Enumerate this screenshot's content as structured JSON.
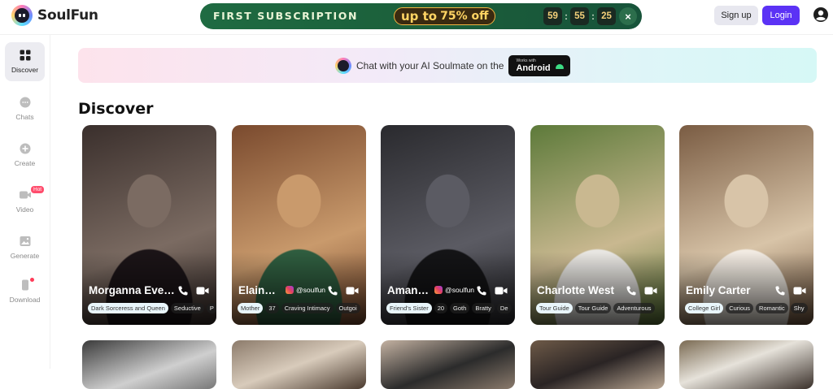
{
  "header": {
    "logo_text": "SoulFun",
    "promo": {
      "title": "FIRST SUBSCRIPTION",
      "offer_prefix": "up to",
      "offer_value": "75% off",
      "timer": [
        "59",
        "55",
        "25"
      ],
      "close": "×"
    },
    "signup_label": "Sign up",
    "login_label": "Login"
  },
  "sidebar": {
    "items": [
      {
        "label": "Discover",
        "icon": "grid-icon"
      },
      {
        "label": "Chats",
        "icon": "chat-bubble-icon"
      },
      {
        "label": "Create",
        "icon": "plus-circle-icon"
      },
      {
        "label": "Video",
        "icon": "video-camera-icon",
        "badge": "Hot"
      },
      {
        "label": "Generate",
        "icon": "image-icon"
      },
      {
        "label": "Download",
        "icon": "phone-download-icon"
      }
    ]
  },
  "banner": {
    "text": "Chat with your AI Soulmate on the",
    "badge_small": "Works with",
    "badge_large": "Android"
  },
  "section_title": "Discover",
  "cards": [
    {
      "name": "Morganna Eve…",
      "social": "",
      "tags": [
        "Dark Sorceress and Queen",
        "Seductive",
        "P"
      ],
      "colors": [
        "#3a2f2c",
        "#7b6b62",
        "#1b1417"
      ]
    },
    {
      "name": "Elain…",
      "social": "@soulfun",
      "tags": [
        "Mother",
        "37",
        "Craving Intimacy",
        "Outgoi"
      ],
      "colors": [
        "#7a4a2e",
        "#c99a6c",
        "#2f5d3f"
      ]
    },
    {
      "name": "Aman…",
      "social": "@soulfun",
      "tags": [
        "Friend's Sister",
        "20",
        "Goth",
        "Bratty",
        "De"
      ],
      "colors": [
        "#2a2a2e",
        "#5b5b63",
        "#141416"
      ]
    },
    {
      "name": "Charlotte West",
      "social": "",
      "tags": [
        "Tour Guide",
        "Tour Guide",
        "Adventurous"
      ],
      "colors": [
        "#5d7a3a",
        "#c9b890",
        "#e8e6e2"
      ]
    },
    {
      "name": "Emily Carter",
      "social": "",
      "tags": [
        "College Girl",
        "Curious",
        "Romantic",
        "Shy"
      ],
      "colors": [
        "#7a5c43",
        "#d8c4a8",
        "#f2ebe2"
      ]
    }
  ]
}
